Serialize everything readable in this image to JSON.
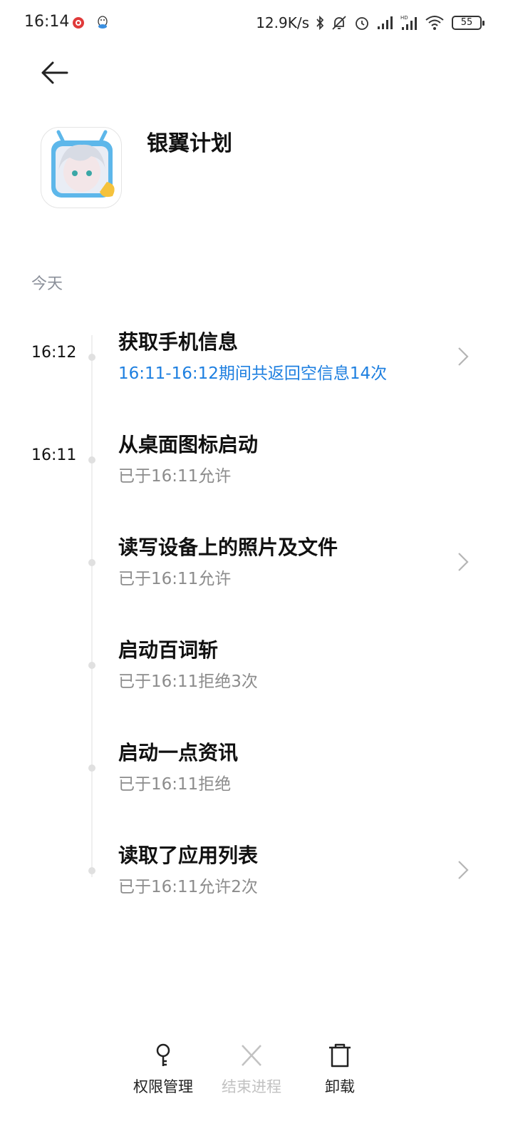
{
  "status_bar": {
    "time": "16:14",
    "net_speed": "12.9K/s",
    "battery": "55",
    "icons": [
      "weibo-notification-icon",
      "qq-notification-icon",
      "bluetooth-icon",
      "mute-icon",
      "alarm-icon",
      "signal-icon",
      "hd-signal-icon",
      "wifi-icon",
      "battery-icon"
    ]
  },
  "header": {
    "back_icon": "arrow-left-icon",
    "app_name": "银翼计划"
  },
  "section_label": "今天",
  "entries": [
    {
      "time": "16:12",
      "title": "获取手机信息",
      "subtitle": "16:11-16:12期间共返回空信息14次",
      "subtitle_color": "#1d7fe0",
      "has_chevron": true
    },
    {
      "time": "16:11",
      "title": "从桌面图标启动",
      "subtitle": "已于16:11允许",
      "has_chevron": false
    },
    {
      "time": "",
      "title": "读写设备上的照片及文件",
      "subtitle": "已于16:11允许",
      "has_chevron": true
    },
    {
      "time": "",
      "title": "启动百词斩",
      "subtitle": "已于16:11拒绝3次",
      "has_chevron": false
    },
    {
      "time": "",
      "title": "启动一点资讯",
      "subtitle": "已于16:11拒绝",
      "has_chevron": false
    },
    {
      "time": "",
      "title": "读取了应用列表",
      "subtitle": "已于16:11允许2次",
      "has_chevron": true
    }
  ],
  "bottom_bar": {
    "permissions_label": "权限管理",
    "end_process_label": "结束进程",
    "uninstall_label": "卸载"
  },
  "colors": {
    "accent": "#1d7fe0",
    "muted": "#8c8c8c",
    "disabled": "#c2c2c2"
  }
}
